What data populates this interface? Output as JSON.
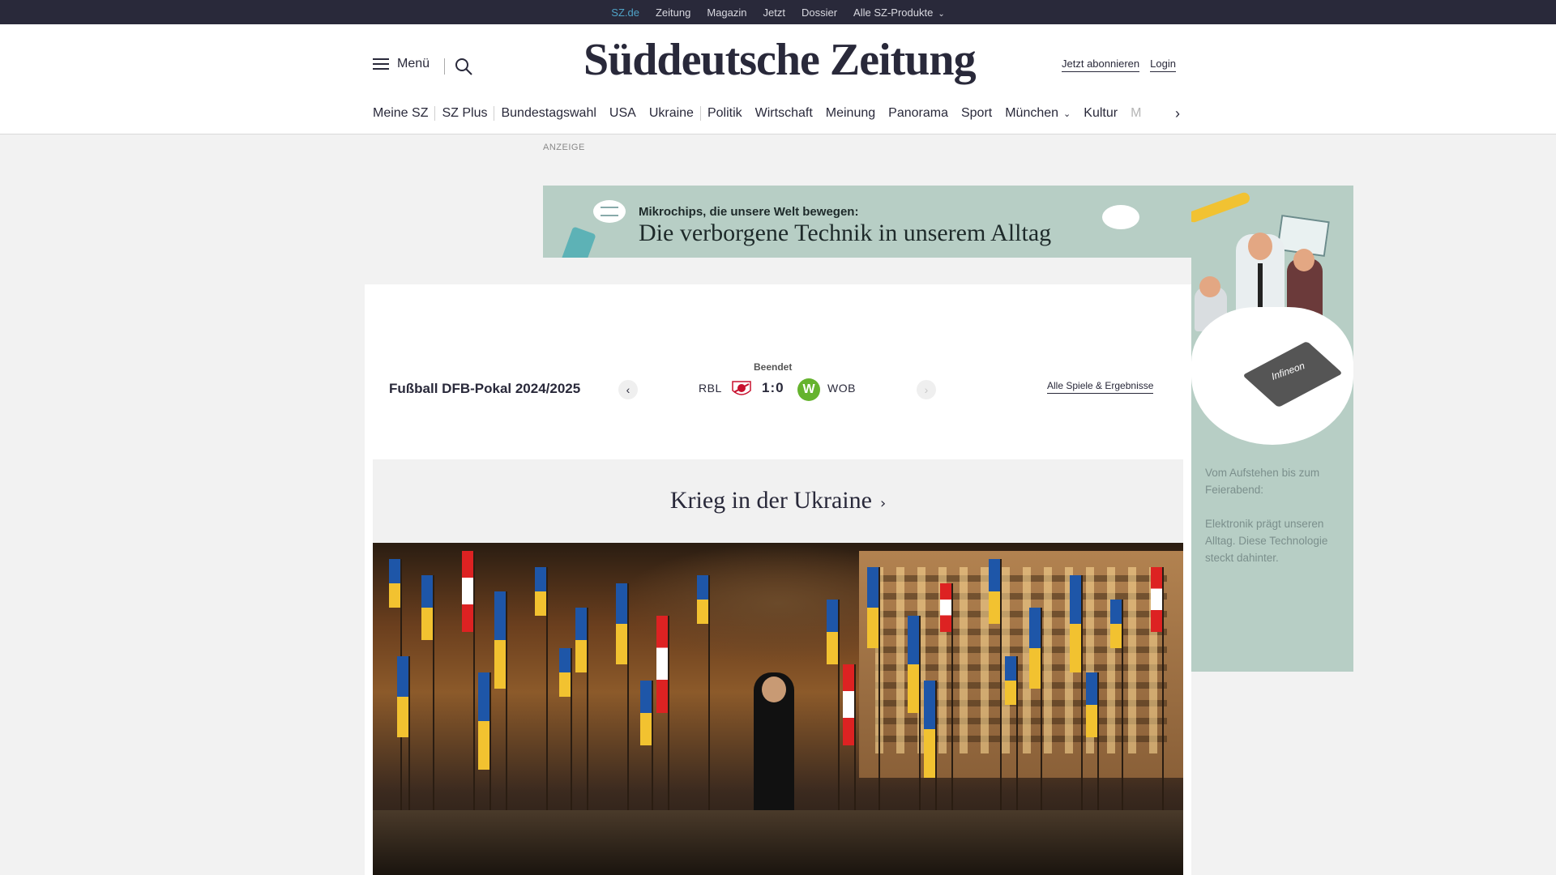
{
  "topbar": {
    "links": [
      {
        "label": "SZ.de",
        "active": true
      },
      {
        "label": "Zeitung"
      },
      {
        "label": "Magazin"
      },
      {
        "label": "Jetzt"
      },
      {
        "label": "Dossier"
      },
      {
        "label": "Alle SZ-Produkte",
        "dropdown": true
      }
    ]
  },
  "header": {
    "menu_label": "Menü",
    "logo": "Süddeutsche Zeitung",
    "subscribe_label": "Jetzt abonnieren",
    "login_label": "Login"
  },
  "nav": {
    "items": [
      "Meine SZ",
      "SZ Plus",
      "Bundestagswahl",
      "USA",
      "Ukraine",
      "Politik",
      "Wirtschaft",
      "Meinung",
      "Panorama",
      "Sport",
      "München",
      "Kultur",
      "M"
    ]
  },
  "ad": {
    "label": "ANZEIGE",
    "kicker": "Mikrochips, die unsere Welt bewegen:",
    "headline": "Die verborgene Technik in unserem Alltag",
    "brand": "Infineon",
    "copy1": "Vom Aufstehen bis zum Feierabend:",
    "copy2": "Elektronik prägt unseren Alltag. Diese Technologie steckt dahinter.",
    "bg_color": "#b7cec5"
  },
  "score": {
    "competition": "Fußball DFB-Pokal 2024/2025",
    "status": "Beendet",
    "home": "RBL",
    "result": "1:0",
    "away": "WOB",
    "all_games_label": "Alle Spiele & Ergebnisse"
  },
  "section": {
    "title": "Krieg in der Ukraine"
  },
  "colors": {
    "dark": "#29293a",
    "active_link": "#4fa3c7",
    "page_bg": "#f2f2f2"
  }
}
